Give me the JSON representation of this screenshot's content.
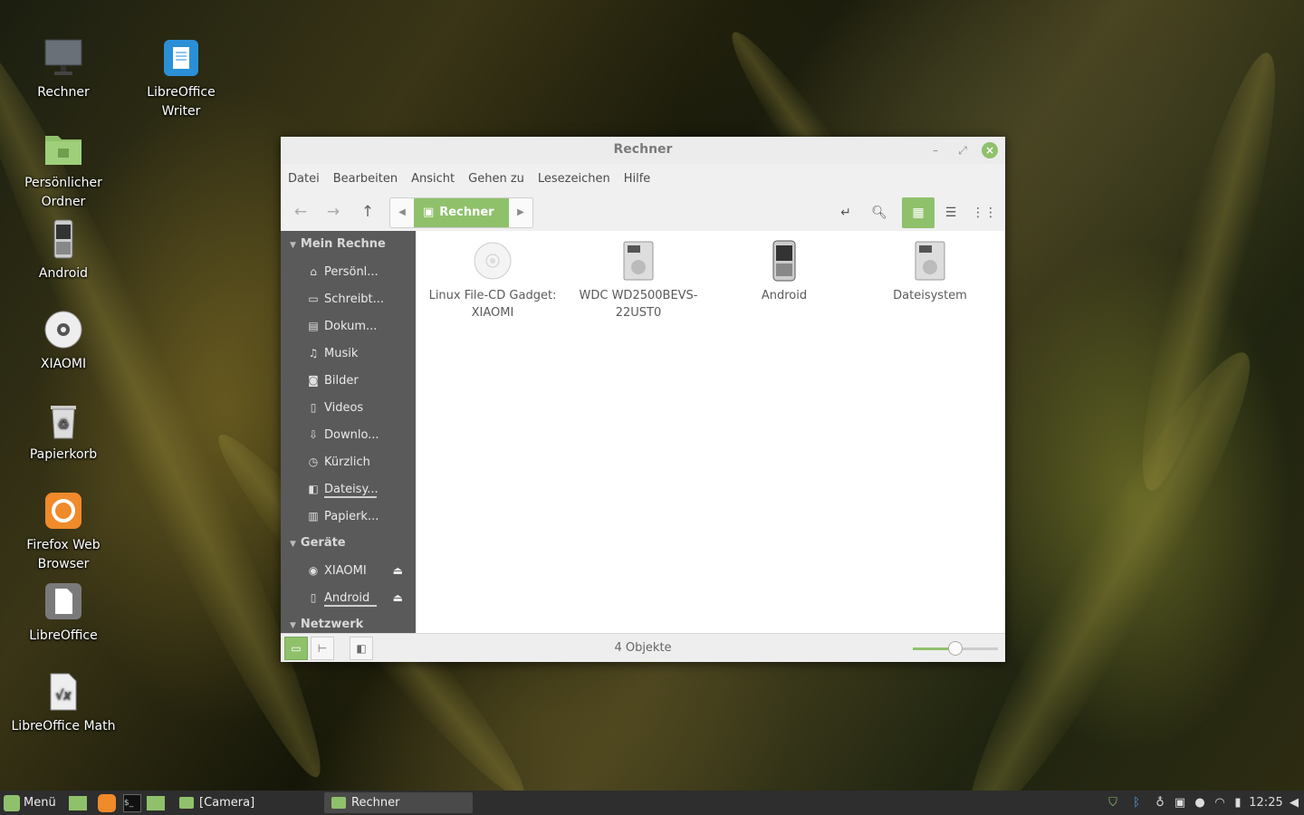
{
  "desktop": {
    "icons": [
      {
        "label": "Rechner",
        "icon": "monitor-icon"
      },
      {
        "label": "LibreOffice Writer",
        "icon": "writer-icon"
      },
      {
        "label": "Persönlicher Ordner",
        "icon": "home-folder-icon"
      },
      {
        "label": "Android",
        "icon": "phone-icon"
      },
      {
        "label": "XIAOMI",
        "icon": "optical-disc-icon"
      },
      {
        "label": "Papierkorb",
        "icon": "trash-icon"
      },
      {
        "label": "Firefox Web Browser",
        "icon": "firefox-icon"
      },
      {
        "label": "LibreOffice",
        "icon": "libreoffice-icon"
      },
      {
        "label": "LibreOffice Math",
        "icon": "math-icon"
      }
    ]
  },
  "window": {
    "title": "Rechner",
    "menu": [
      "Datei",
      "Bearbeiten",
      "Ansicht",
      "Gehen zu",
      "Lesezeichen",
      "Hilfe"
    ],
    "path": {
      "current": "Rechner"
    },
    "sidebar": {
      "sections": [
        {
          "title": "Mein Rechne",
          "items": [
            {
              "label": "Persönl...",
              "icon": "home-icon"
            },
            {
              "label": "Schreibt...",
              "icon": "desktop-icon"
            },
            {
              "label": "Dokum...",
              "icon": "document-icon"
            },
            {
              "label": "Musik",
              "icon": "music-icon"
            },
            {
              "label": "Bilder",
              "icon": "camera-icon"
            },
            {
              "label": "Videos",
              "icon": "film-icon"
            },
            {
              "label": "Downlo...",
              "icon": "download-icon"
            },
            {
              "label": "Kürzlich",
              "icon": "clock-icon"
            },
            {
              "label": "Dateisy...",
              "icon": "drive-icon"
            },
            {
              "label": "Papierk...",
              "icon": "trash-icon"
            }
          ]
        },
        {
          "title": "Geräte",
          "items": [
            {
              "label": "XIAOMI",
              "icon": "disc-icon"
            },
            {
              "label": "Android",
              "icon": "phone-icon"
            }
          ]
        },
        {
          "title": "Netzwerk",
          "items": []
        }
      ]
    },
    "files": [
      {
        "label": "Linux File-CD Gadget: XIAOMI",
        "icon": "optical-disc-icon"
      },
      {
        "label": "WDC WD2500BEVS-22UST0",
        "icon": "harddisk-icon"
      },
      {
        "label": "Android",
        "icon": "phone-icon"
      },
      {
        "label": "Dateisystem",
        "icon": "harddisk-icon"
      }
    ],
    "status": "4 Objekte",
    "zoom_level": 0.5
  },
  "taskbar": {
    "menu_label": "Menü",
    "tasks": [
      "[Camera]",
      "Rechner"
    ],
    "clock": "12:25"
  },
  "colors": {
    "accent": "#8fc16b",
    "sidebar_bg": "#5a5a5a",
    "taskbar_bg": "#2e2e2e"
  }
}
